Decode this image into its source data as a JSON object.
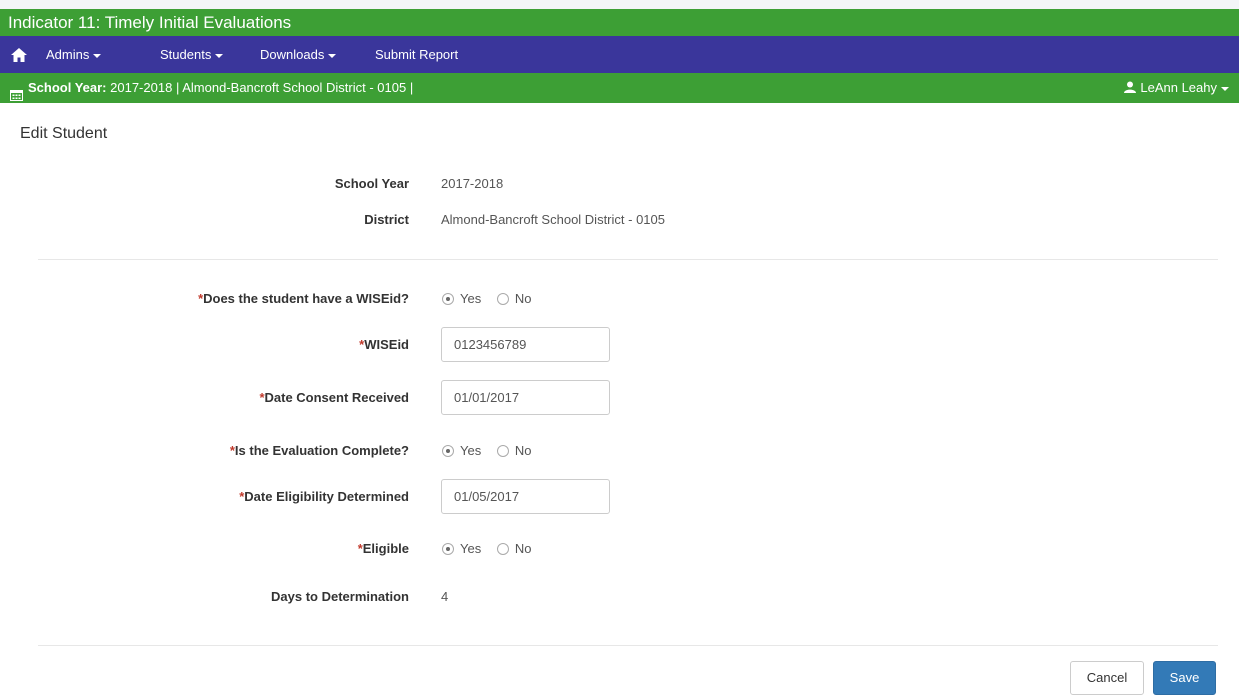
{
  "app": {
    "title": "Indicator 11: Timely Initial Evaluations"
  },
  "nav": {
    "home_icon": "home-icon",
    "items": [
      {
        "label": "Admins",
        "dropdown": true
      },
      {
        "label": "Students",
        "dropdown": true
      },
      {
        "label": "Downloads",
        "dropdown": true
      },
      {
        "label": "Submit Report",
        "dropdown": false
      }
    ]
  },
  "context": {
    "school_year_label": "School Year:",
    "school_year_value": "2017-2018",
    "separator": "|",
    "district": "Almond-Bancroft School District - 0105",
    "trailing_separator": "|",
    "user": "LeAnn Leahy"
  },
  "page": {
    "title": "Edit Student"
  },
  "info": {
    "school_year_label": "School Year",
    "school_year": "2017-2018",
    "district_label": "District",
    "district": "Almond-Bancroft School District - 0105"
  },
  "form": {
    "required_marker": "*",
    "has_wiseid": {
      "label": "Does the student have a WISEid?",
      "yes": "Yes",
      "no": "No",
      "selected": "Yes"
    },
    "wiseid": {
      "label": "WISEid",
      "value": "0123456789"
    },
    "date_consent": {
      "label": "Date Consent Received",
      "value": "01/01/2017"
    },
    "eval_complete": {
      "label": "Is the Evaluation Complete?",
      "yes": "Yes",
      "no": "No",
      "selected": "Yes"
    },
    "date_eligibility": {
      "label": "Date Eligibility Determined",
      "value": "01/05/2017"
    },
    "eligible": {
      "label": "Eligible",
      "yes": "Yes",
      "no": "No",
      "selected": "Yes"
    },
    "days_to_determination": {
      "label": "Days to Determination",
      "value": "4"
    }
  },
  "actions": {
    "cancel": "Cancel",
    "save": "Save"
  },
  "colors": {
    "header_green": "#3d9f35",
    "nav_purple": "#3a369b",
    "save_blue": "#337ab7"
  }
}
